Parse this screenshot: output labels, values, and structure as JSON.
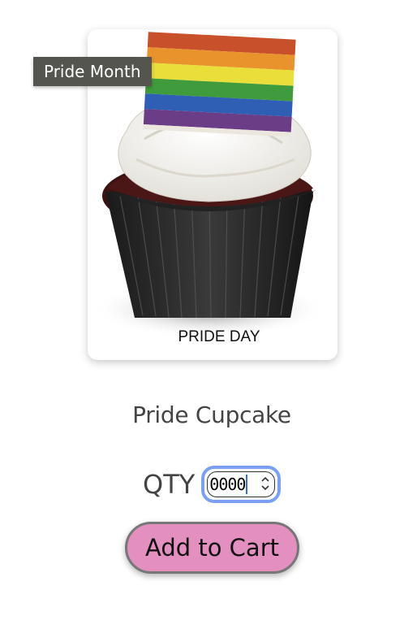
{
  "product": {
    "tooltip": "Pride Month",
    "image_caption": "PRIDE DAY",
    "name": "Pride Cupcake"
  },
  "quantity": {
    "label": "QTY",
    "value": "0000"
  },
  "actions": {
    "add_to_cart_label": "Add to Cart"
  },
  "colors": {
    "button_bg": "#e38fc0",
    "focus_ring": "#7b9ff5",
    "tooltip_bg": "#55554f",
    "text": "#444444"
  },
  "icons": {
    "quantity_spinner": "up-down-chevron-icon"
  }
}
